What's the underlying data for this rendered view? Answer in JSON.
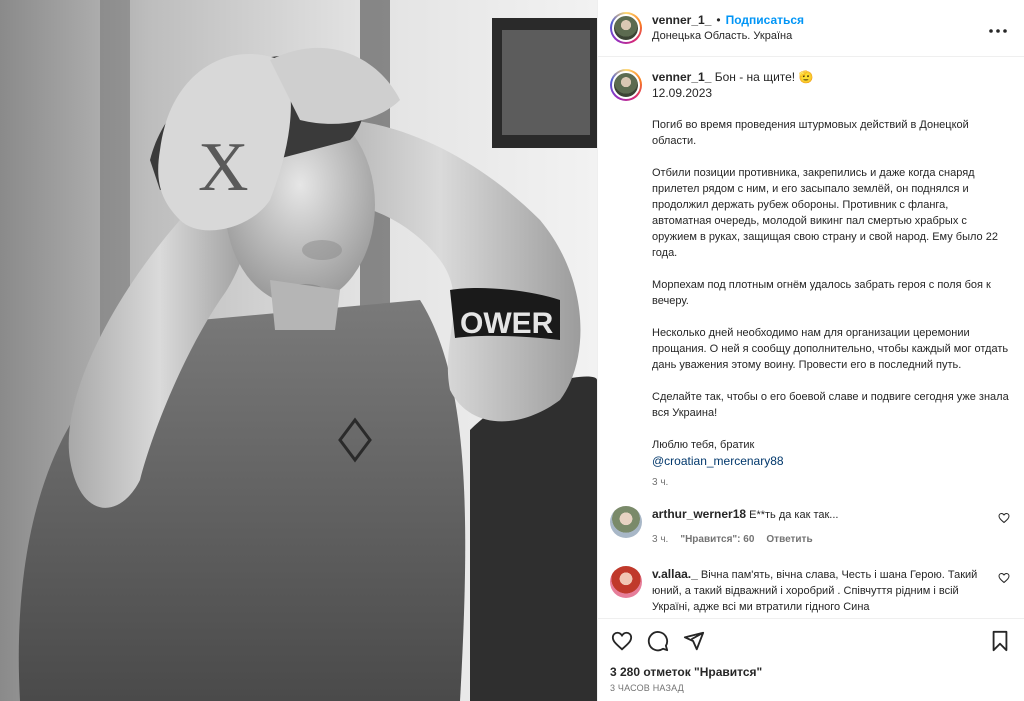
{
  "post": {
    "username": "venner_1_",
    "separator": "•",
    "follow_label": "Подписаться",
    "location": "Донецька Область. Україна",
    "more_icon": "more-horizontal-icon"
  },
  "caption": {
    "username": "venner_1_",
    "title": "Бон - на щите!",
    "emoji": "🫡",
    "date": "12.09.2023",
    "paragraphs": [
      "Погиб во время проведения штурмовых действий в Донецкой области.",
      "Отбили позиции противника, закрепились и даже когда снаряд прилетел рядом с ним, и его засыпало землёй, он поднялся и продолжил держать рубеж обороны. Противник с фланга, автоматная очередь, молодой викинг пал смертью храбрых с оружием в руках, защищая свою страну и свой народ. Ему было 22 года.",
      "Морпехам под плотным огнём удалось забрать героя с поля боя к вечеру.",
      "Несколько дней необходимо нам для организации церемонии прощания. О ней я сообщу дополнительно, чтобы каждый мог отдать дань уважения этому воину. Провести его в последний путь.",
      "Сделайте так, чтобы о его боевой славе и подвиге сегодня уже знала вся Украина!",
      "Люблю тебя, братик"
    ],
    "mention": "@croatian_mercenary88",
    "time": "3 ч."
  },
  "comments": [
    {
      "username": "arthur_werner18",
      "text": "Е**ть да как так...",
      "time": "3 ч.",
      "likes": "\"Нравится\": 60",
      "reply": "Ответить"
    },
    {
      "username": "v.allaa._",
      "text": "Вічна пам'ять, вічна слава, Честь і шана Герою. Такий юний, а такий відважний і хоробрий . Співчуття рідним і всій Україні, адже всі ми втратили гідного Сина"
    }
  ],
  "actions": {
    "like_icon": "heart-icon",
    "comment_icon": "comment-icon",
    "share_icon": "share-icon",
    "save_icon": "bookmark-icon"
  },
  "likes_text": "3 280 отметок \"Нравится\"",
  "posted_ago": "3 ЧАСОВ НАЗАД",
  "photo": {
    "tattoo_text": "OWER"
  },
  "colors": {
    "follow": "#0095f6",
    "mention": "#00376b",
    "muted": "#737373"
  }
}
